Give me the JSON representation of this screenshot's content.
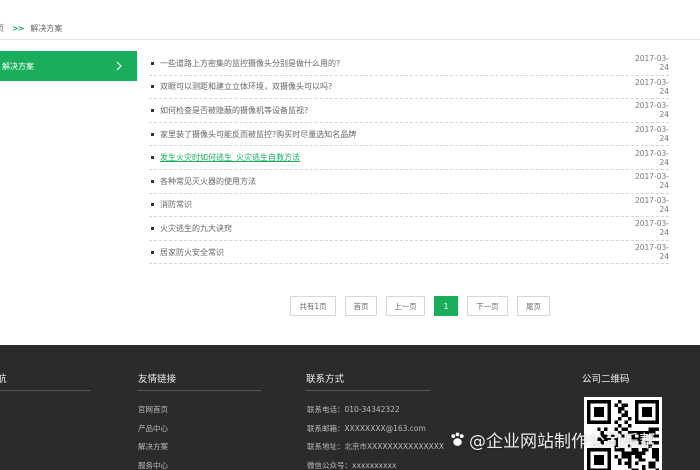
{
  "breadcrumb": {
    "home": "页",
    "separator": ">>",
    "current": "解决方案"
  },
  "sidebar": {
    "active_item": "解决方案"
  },
  "news": [
    {
      "title": "一些道路上方密集的监控摄像头分别是做什么用的?",
      "date": "2017-03-24",
      "highlighted": false
    },
    {
      "title": "双眼可以测距和建立立体环境，双摄像头可以吗?",
      "date": "2017-03-24",
      "highlighted": false
    },
    {
      "title": "如何检查是否被隐蔽的摄像机等设备监视?",
      "date": "2017-03-24",
      "highlighted": false
    },
    {
      "title": "家里装了摄像头可能反而被监控?购买时尽量选知名品牌",
      "date": "2017-03-24",
      "highlighted": false
    },
    {
      "title": "发生火灾时如何逃生_火灾逃生自救方法",
      "date": "2017-03-24",
      "highlighted": true
    },
    {
      "title": "各种常见灭火器的使用方法",
      "date": "2017-03-24",
      "highlighted": false
    },
    {
      "title": "消防常识",
      "date": "2017-03-24",
      "highlighted": false
    },
    {
      "title": "火灾逃生的九大诀窍",
      "date": "2017-03-24",
      "highlighted": false
    },
    {
      "title": "居家防火安全常识",
      "date": "2017-03-24",
      "highlighted": false
    }
  ],
  "pagination": {
    "total": "共有1页",
    "first": "首页",
    "prev": "上一页",
    "current": "1",
    "next": "下一页",
    "last": "尾页"
  },
  "footer": {
    "nav_title": "航",
    "links_title": "友情链接",
    "links": [
      "官网首页",
      "产品中心",
      "解决方案",
      "服务中心"
    ],
    "contact_title": "联系方式",
    "contact": [
      "联系电话：010-34342322",
      "联系邮箱：XXXXXXXX@163.com",
      "联系地址：北京市XXXXXXXXXXXXXXX",
      "微信公众号：xxxxxxxxxx"
    ],
    "qr_title": "公司二维码"
  },
  "watermark": "@企业网站制作公司乐帮",
  "colors": {
    "accent": "#1aad5c",
    "footer_bg": "#2b2b2b"
  }
}
